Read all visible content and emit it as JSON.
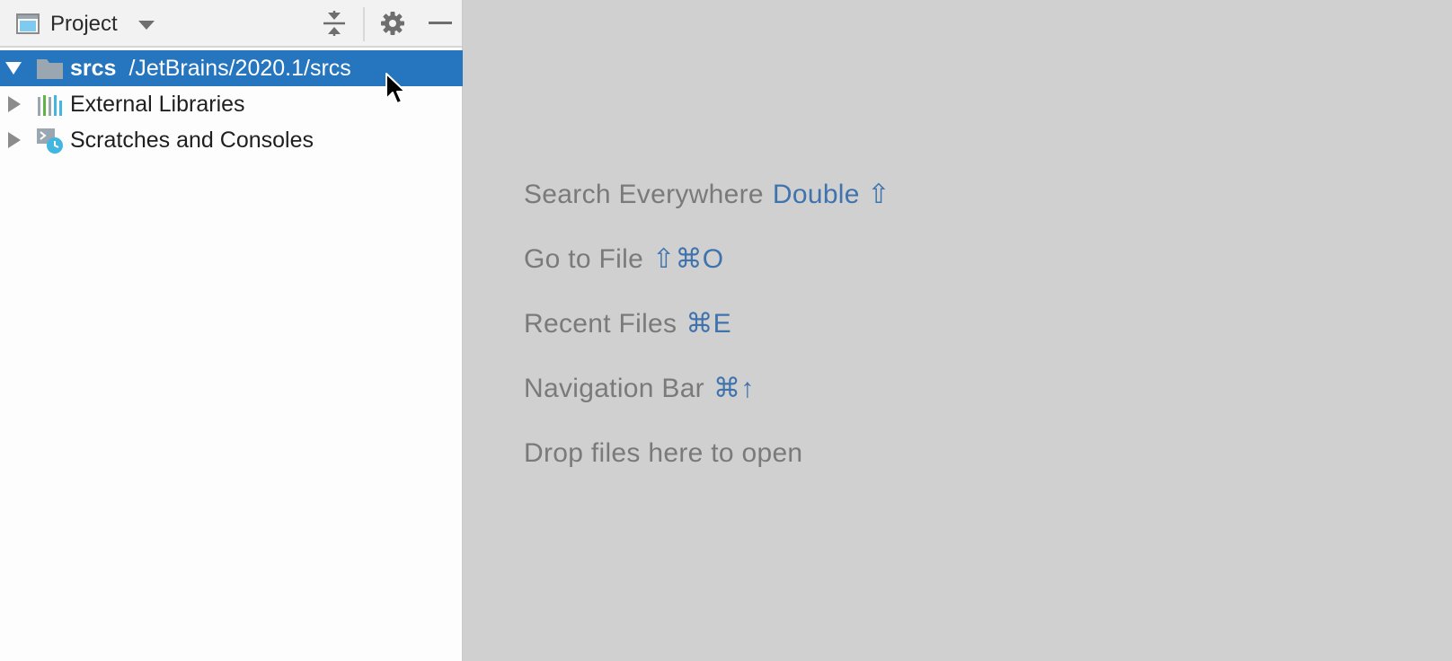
{
  "project_panel": {
    "view_name": "Project",
    "tree": [
      {
        "name": "srcs",
        "path": "/JetBrains/2020.1/srcs",
        "expanded": true,
        "selected": true,
        "icon": "folder-icon"
      },
      {
        "name": "External Libraries",
        "expanded": false,
        "selected": false,
        "icon": "libraries-icon"
      },
      {
        "name": "Scratches and Consoles",
        "expanded": false,
        "selected": false,
        "icon": "scratches-icon"
      }
    ]
  },
  "editor_hints": [
    {
      "label": "Search Everywhere",
      "shortcut": "Double ⇧"
    },
    {
      "label": "Go to File",
      "shortcut": "⇧⌘O"
    },
    {
      "label": "Recent Files",
      "shortcut": "⌘E"
    },
    {
      "label": "Navigation Bar",
      "shortcut": "⌘↑"
    },
    {
      "label": "Drop files here to open",
      "shortcut": ""
    }
  ],
  "colors": {
    "selection": "#2675bf",
    "editor_background": "#d0d0d0",
    "hint_text": "#7a7a7a",
    "shortcut_text": "#3f73ad"
  }
}
